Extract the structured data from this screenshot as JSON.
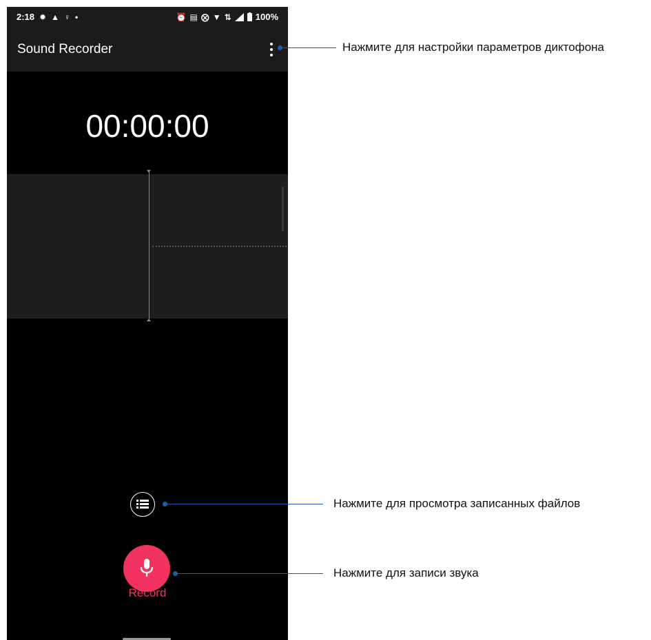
{
  "status_bar": {
    "time": "2:18",
    "left_icons": [
      "gear-icon",
      "warning-icon",
      "bulb-icon",
      "dot-icon"
    ],
    "right_icons": [
      "alarm-icon",
      "nfc-icon",
      "mute-icon",
      "wifi-icon",
      "data-icon",
      "signal-icon",
      "battery-icon"
    ],
    "battery": "100%"
  },
  "app_bar": {
    "title": "Sound Recorder",
    "more_icon": "more-vert-icon"
  },
  "timer": "00:00:00",
  "controls": {
    "list_icon": "list-icon",
    "record_icon": "microphone-icon",
    "record_label": "Record",
    "record_color": "#f2325f"
  },
  "callouts": {
    "settings": "Нажмите для настройки параметров диктофона",
    "files": "Нажмите для просмотра записанных файлов",
    "record": "Нажмите для записи звука",
    "line_color": "#1a5fa8"
  }
}
